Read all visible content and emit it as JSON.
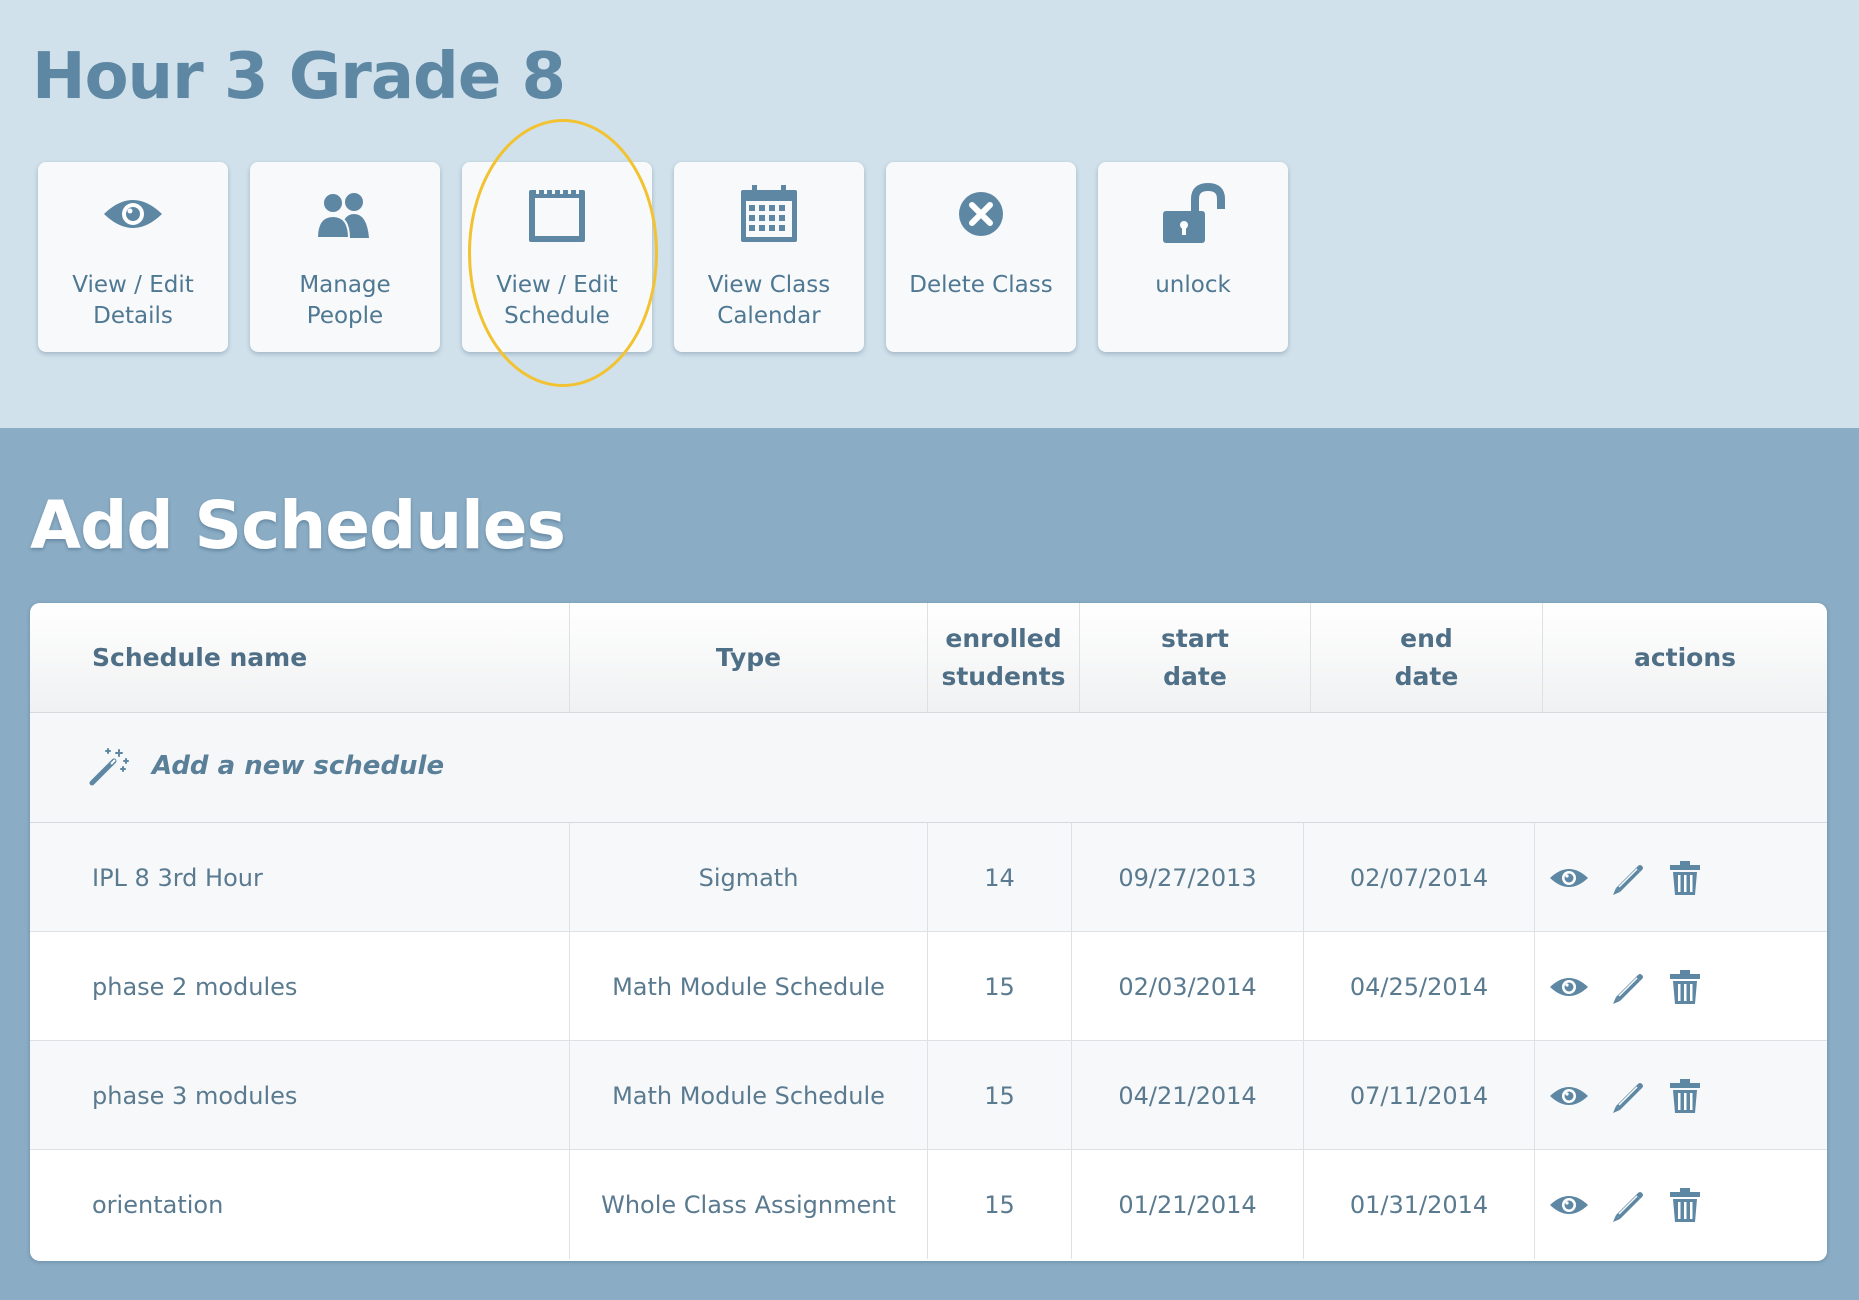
{
  "page": {
    "title": "Hour 3 Grade 8"
  },
  "actions": [
    {
      "icon": "eye-icon",
      "label": "View / Edit Details"
    },
    {
      "icon": "people-icon",
      "label": "Manage People"
    },
    {
      "icon": "notepad-icon",
      "label": "View / Edit Schedule"
    },
    {
      "icon": "calendar-icon",
      "label": "View Class Calendar"
    },
    {
      "icon": "circle-x-icon",
      "label": "Delete Class"
    },
    {
      "icon": "unlock-icon",
      "label": "unlock"
    }
  ],
  "colors": {
    "top_bg": "#d0e1eb",
    "page_bg": "#8aacc4",
    "accent": "#5e87a4",
    "highlight": "#f2c230"
  },
  "section": {
    "title": "Add Schedules"
  },
  "table": {
    "columns": [
      "Schedule name",
      "Type",
      "enrolled\nstudents",
      "start\ndate",
      "end\ndate",
      "actions"
    ],
    "add_label": "Add a new schedule",
    "rows": [
      {
        "name": "IPL 8 3rd Hour",
        "type": "Sigmath",
        "enrolled": "14",
        "start": "09/27/2013",
        "end": "02/07/2014"
      },
      {
        "name": "phase 2 modules",
        "type": "Math Module Schedule",
        "enrolled": "15",
        "start": "02/03/2014",
        "end": "04/25/2014"
      },
      {
        "name": "phase 3 modules",
        "type": "Math Module Schedule",
        "enrolled": "15",
        "start": "04/21/2014",
        "end": "07/11/2014"
      },
      {
        "name": "orientation",
        "type": "Whole Class Assignment",
        "enrolled": "15",
        "start": "01/21/2014",
        "end": "01/31/2014"
      }
    ],
    "row_actions": [
      "view-icon",
      "edit-icon",
      "delete-icon"
    ]
  }
}
